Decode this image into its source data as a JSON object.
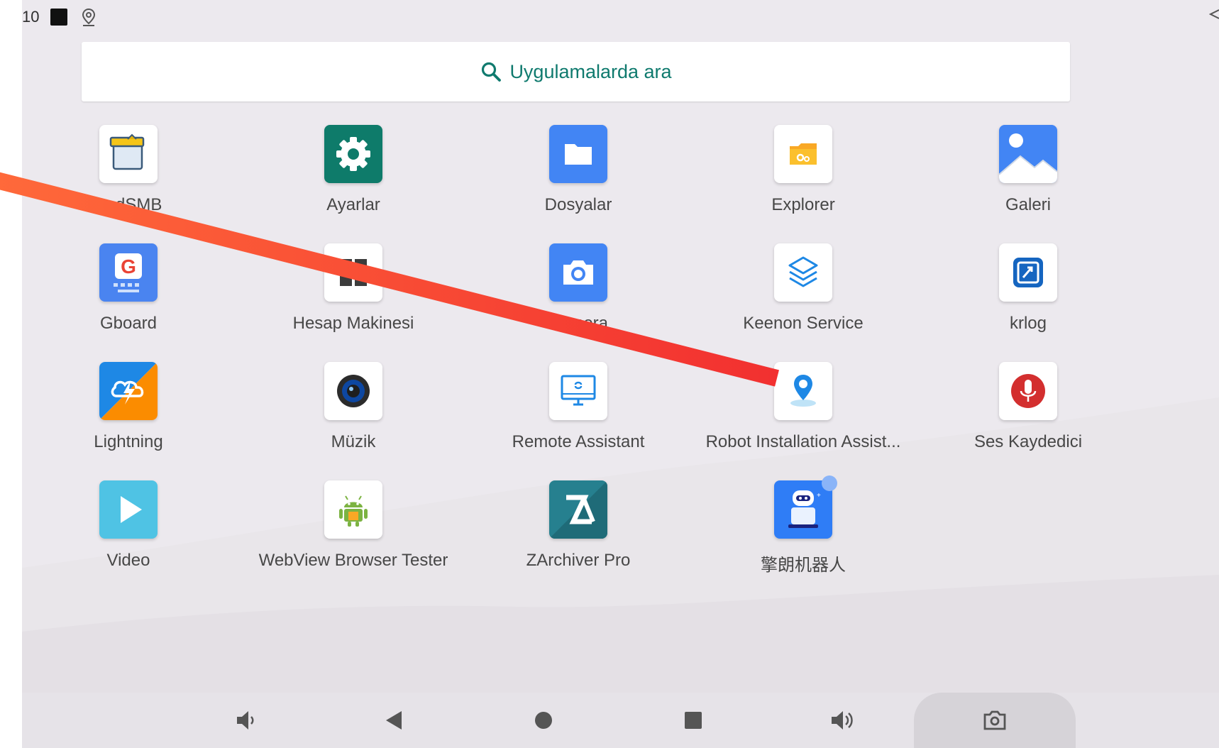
{
  "status_bar": {
    "time": "10"
  },
  "search": {
    "placeholder": "Uygulamalarda ara"
  },
  "apps": [
    {
      "label": "AndSMB",
      "icon": "andsmb-icon"
    },
    {
      "label": "Ayarlar",
      "icon": "settings-gear-icon"
    },
    {
      "label": "Dosyalar",
      "icon": "folder-icon"
    },
    {
      "label": "Explorer",
      "icon": "explorer-folder-icon"
    },
    {
      "label": "Galeri",
      "icon": "gallery-icon"
    },
    {
      "label": "Gboard",
      "icon": "gboard-icon"
    },
    {
      "label": "Hesap Makinesi",
      "icon": "calculator-icon"
    },
    {
      "label": "Kamera",
      "icon": "camera-icon"
    },
    {
      "label": "Keenon Service",
      "icon": "layers-icon"
    },
    {
      "label": "krlog",
      "icon": "krlog-icon"
    },
    {
      "label": "Lightning",
      "icon": "lightning-icon"
    },
    {
      "label": "Müzik",
      "icon": "speaker-icon"
    },
    {
      "label": "Remote Assistant",
      "icon": "monitor-icon"
    },
    {
      "label": "Robot Installation Assist...",
      "icon": "location-pin-icon"
    },
    {
      "label": "Ses Kaydedici",
      "icon": "microphone-icon"
    },
    {
      "label": "Video",
      "icon": "play-icon"
    },
    {
      "label": "WebView Browser Tester",
      "icon": "android-icon"
    },
    {
      "label": "ZArchiver Pro",
      "icon": "zarchiver-icon"
    },
    {
      "label": "擎朗机器人",
      "icon": "robot-icon"
    }
  ],
  "nav_bar": {
    "items": [
      "volume-down-icon",
      "back-icon",
      "home-icon",
      "recents-icon",
      "volume-up-icon",
      "screenshot-icon"
    ]
  },
  "colors": {
    "search_accent": "#0f7a6e",
    "annotation_arrow_start": "#ff6a3a",
    "annotation_arrow_end": "#f23030"
  }
}
